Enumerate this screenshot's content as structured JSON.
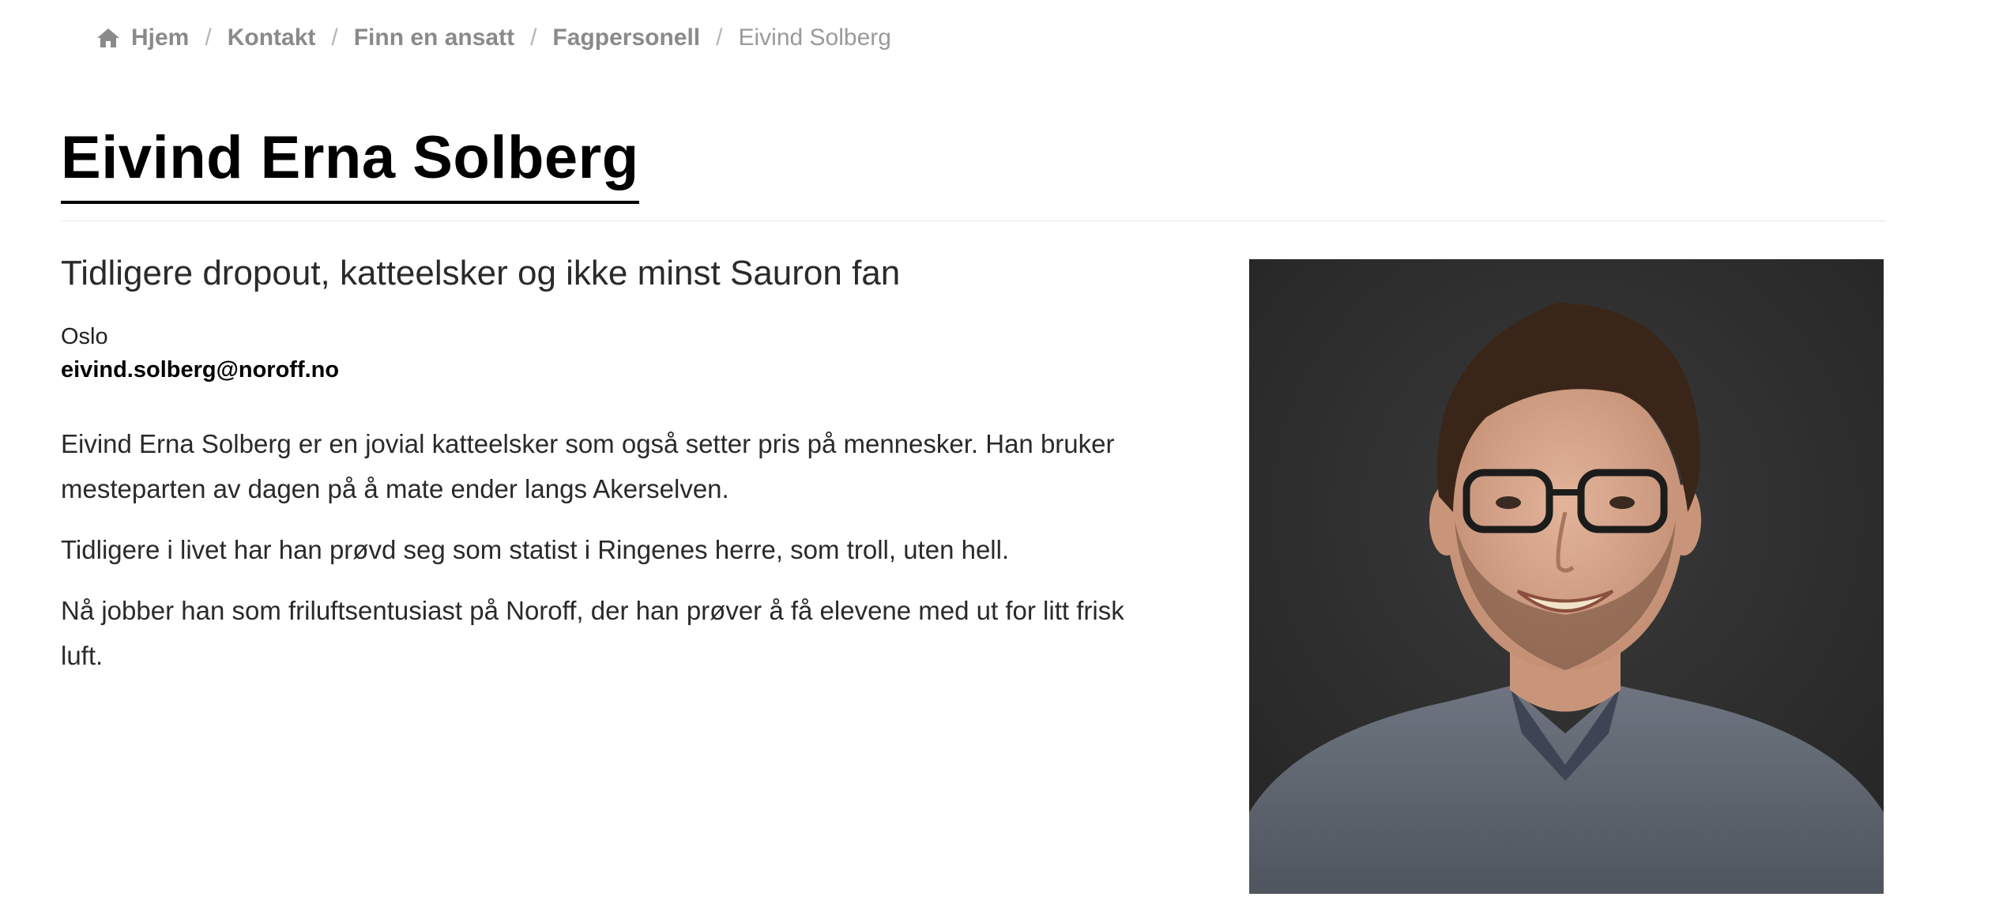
{
  "breadcrumb": {
    "home": "Hjem",
    "contact": "Kontakt",
    "find_employee": "Finn en ansatt",
    "professionals": "Fagpersonell",
    "current": "Eivind Solberg",
    "separator": "/",
    "home_icon": "home-icon"
  },
  "profile": {
    "name": "Eivind Erna Solberg",
    "tagline": "Tidligere dropout, katteelsker og ikke minst Sauron fan",
    "location": "Oslo",
    "email": "eivind.solberg@noroff.no",
    "bio": [
      "Eivind Erna Solberg er en jovial katteelsker som også setter pris på mennesker. Han bruker mesteparten av dagen på å mate ender langs Akerselven.",
      "Tidligere i livet har han prøvd seg som statist i Ringenes herre, som troll, uten hell.",
      "Nå jobber han som friluftsentusiast på Noroff, der han prøver å få elevene med ut for litt frisk luft."
    ]
  },
  "colors": {
    "breadcrumb_link": "#8a8a8a",
    "title": "#000000",
    "text": "#2a2a2a",
    "photo_background": "#2f2f2f"
  }
}
